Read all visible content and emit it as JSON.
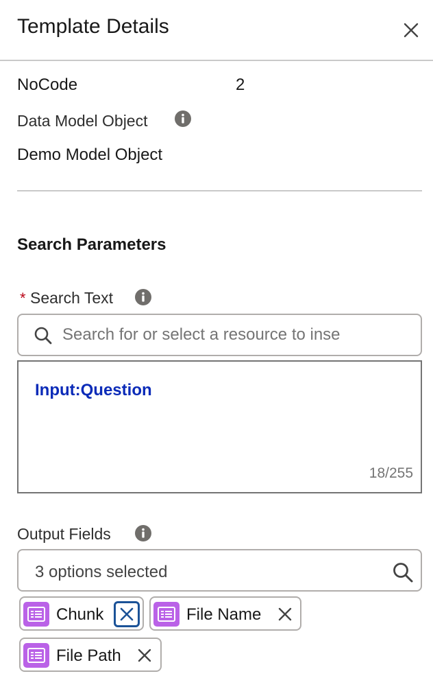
{
  "header": {
    "title": "Template Details",
    "close_icon": "close-icon"
  },
  "details": {
    "nocode_label": "NoCode",
    "nocode_value": "2",
    "dmo_label": "Data Model Object",
    "dmo_value": "Demo Model Object"
  },
  "search_parameters": {
    "title": "Search Parameters",
    "search_text": {
      "required_marker": "*",
      "label": "Search Text",
      "placeholder": "Search for or select a resource to inse",
      "value": "Input:Question",
      "counter": "18/255"
    },
    "output_fields": {
      "label": "Output Fields",
      "selected_summary": "3 options selected",
      "pills": [
        {
          "label": "Chunk",
          "icon": "record-icon"
        },
        {
          "label": "File Name",
          "icon": "record-icon"
        },
        {
          "label": "File Path",
          "icon": "record-icon"
        }
      ]
    }
  },
  "colors": {
    "accent_token": "#0b2bb8",
    "pill_icon": "#ba62e7",
    "required": "#ba0517",
    "focus_ring": "#1b5297"
  }
}
